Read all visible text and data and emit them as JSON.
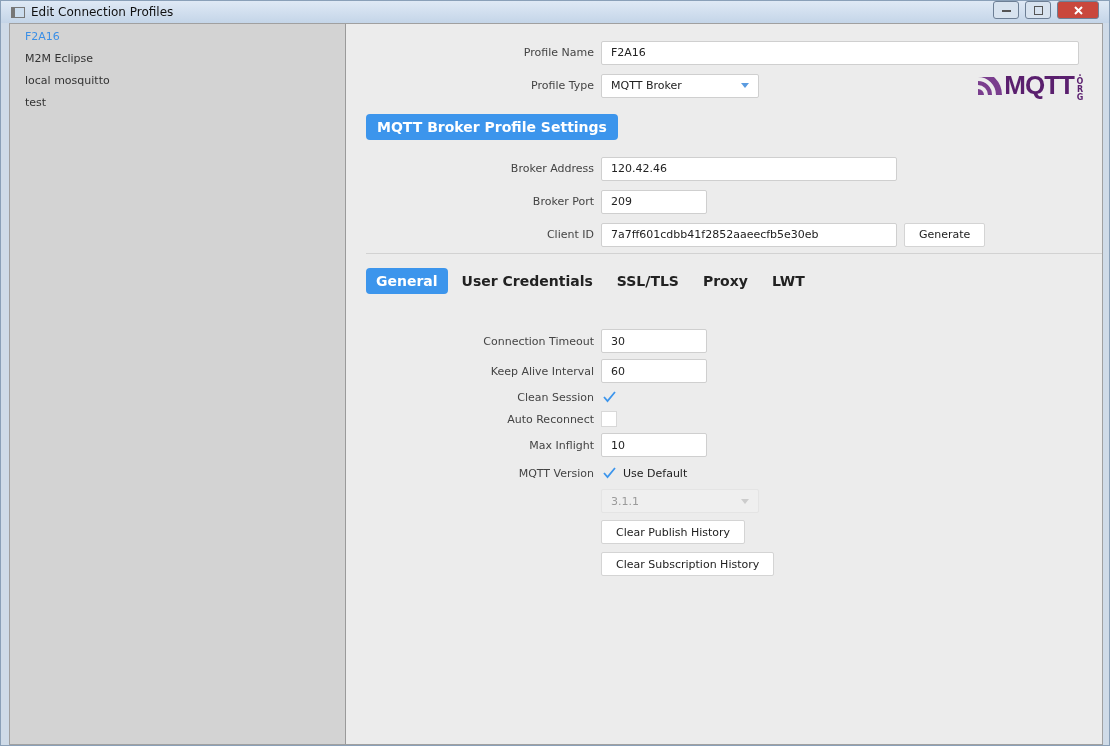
{
  "window": {
    "title": "Edit Connection Profiles"
  },
  "sidebar": {
    "items": [
      {
        "label": "F2A16",
        "selected": true
      },
      {
        "label": "M2M Eclipse",
        "selected": false
      },
      {
        "label": "local mosquitto",
        "selected": false
      },
      {
        "label": "test",
        "selected": false
      }
    ]
  },
  "profile": {
    "name_label": "Profile Name",
    "name_value": "F2A16",
    "type_label": "Profile Type",
    "type_value": "MQTT Broker"
  },
  "logo": {
    "text": "MQTT",
    "suffix": ".ORG"
  },
  "section_title": "MQTT Broker Profile Settings",
  "broker": [
    {
      "label": "Broker Address",
      "value": "120.42.46",
      "kind": "wide"
    },
    {
      "label": "Broker Port",
      "value": "209",
      "kind": "short"
    },
    {
      "label": "Client ID",
      "value": "7a7ff601cdbb41f2852aaeecfb5e30eb",
      "kind": "wide",
      "button": "Generate"
    }
  ],
  "tabs": [
    {
      "label": "General",
      "selected": true
    },
    {
      "label": "User Credentials",
      "selected": false
    },
    {
      "label": "SSL/TLS",
      "selected": false
    },
    {
      "label": "Proxy",
      "selected": false
    },
    {
      "label": "LWT",
      "selected": false
    }
  ],
  "general": [
    {
      "kind": "text",
      "label": "Connection Timeout",
      "value": "30"
    },
    {
      "kind": "text",
      "label": "Keep Alive Interval",
      "value": "60"
    },
    {
      "kind": "checkbox",
      "label": "Clean Session",
      "checked": true
    },
    {
      "kind": "checkbox",
      "label": "Auto Reconnect",
      "checked": false
    },
    {
      "kind": "text",
      "label": "Max Inflight",
      "value": "10"
    },
    {
      "kind": "checkbox",
      "label": "MQTT Version",
      "checked": true,
      "caption": "Use Default"
    },
    {
      "kind": "select",
      "value": "3.1.1",
      "disabled": true
    },
    {
      "kind": "button",
      "text": "Clear Publish History"
    },
    {
      "kind": "button",
      "text": "Clear Subscription History"
    }
  ]
}
